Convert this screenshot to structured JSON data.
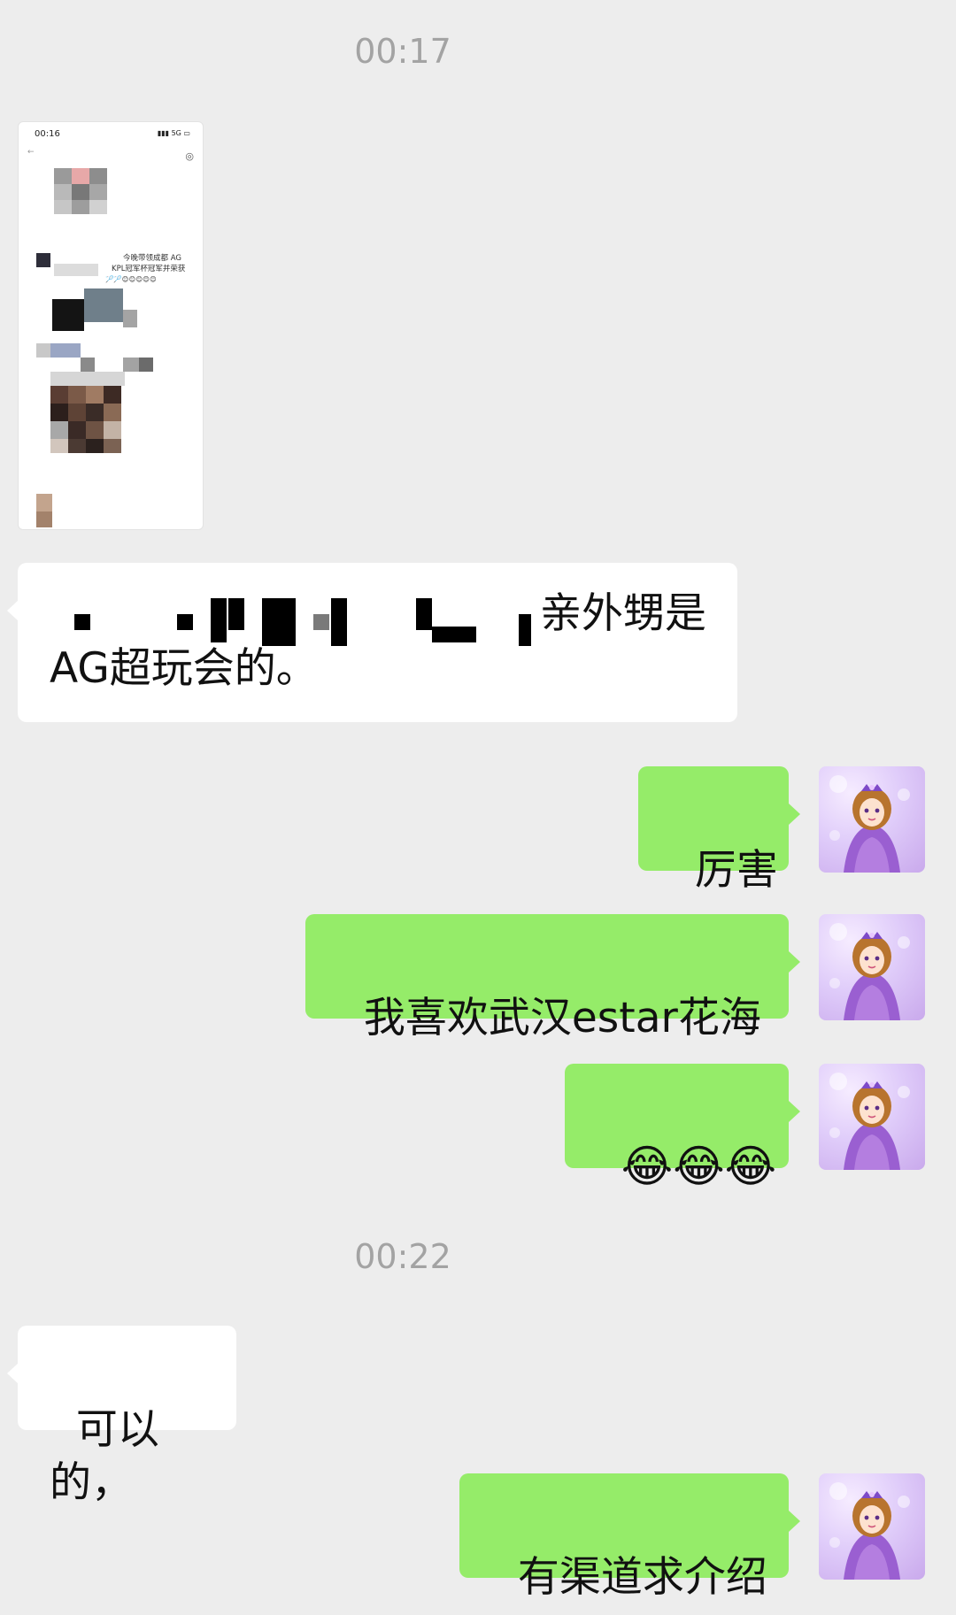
{
  "timestamps": [
    "00:17",
    "00:22"
  ],
  "screenshot_thumb": {
    "status_time": "00:16",
    "status_right": "5G",
    "caption_line1": "今晚带领成都 AG",
    "caption_line2": "KPL冠军杯冠军并荣获",
    "emoji_row": "🏸🏸😊😊😊😊😊"
  },
  "messages": [
    {
      "side": "left",
      "line1_visible": "亲外甥是",
      "line2": "AG超玩会的。"
    },
    {
      "side": "right",
      "text": "厉害"
    },
    {
      "side": "right",
      "text": "我喜欢武汉estar花海"
    },
    {
      "side": "right",
      "text": "😂😂😂"
    },
    {
      "side": "left",
      "text": "可以的，"
    },
    {
      "side": "right",
      "text": "有渠道求介绍"
    }
  ],
  "avatar_icon": "purple-princess-avatar",
  "colors": {
    "background": "#ededed",
    "sent_bubble": "#95ec69",
    "received_bubble": "#ffffff",
    "timestamp": "#a3a3a3"
  }
}
